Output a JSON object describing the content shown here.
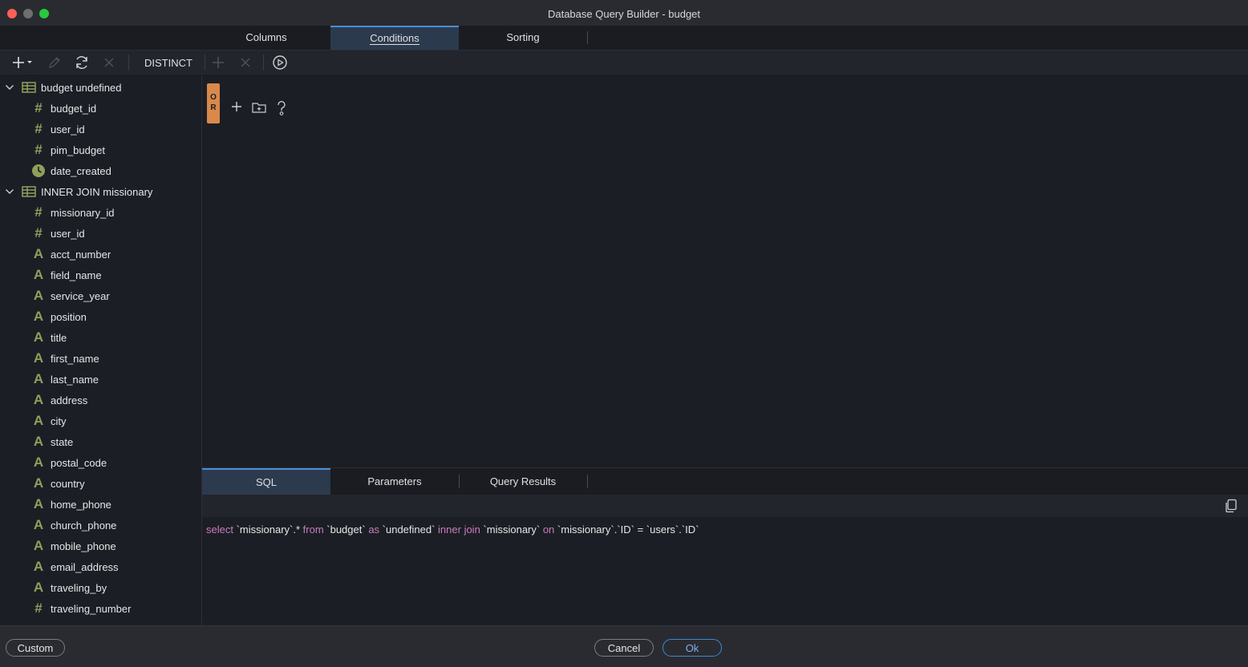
{
  "window": {
    "title": "Database Query Builder - budget"
  },
  "top_tabs": [
    {
      "label": "Columns"
    },
    {
      "label": "Conditions"
    },
    {
      "label": "Sorting"
    }
  ],
  "toolbar": {
    "distinct_label": "DISTINCT"
  },
  "tree": {
    "table1": {
      "label": "budget undefined",
      "fields": [
        {
          "label": "budget_id",
          "type": "#"
        },
        {
          "label": "user_id",
          "type": "#"
        },
        {
          "label": "pim_budget",
          "type": "#"
        },
        {
          "label": "date_created",
          "type": "clock"
        }
      ]
    },
    "table2": {
      "label": "INNER JOIN missionary",
      "fields": [
        {
          "label": "missionary_id",
          "type": "#"
        },
        {
          "label": "user_id",
          "type": "#"
        },
        {
          "label": "acct_number",
          "type": "A"
        },
        {
          "label": "field_name",
          "type": "A"
        },
        {
          "label": "service_year",
          "type": "A"
        },
        {
          "label": "position",
          "type": "A"
        },
        {
          "label": "title",
          "type": "A"
        },
        {
          "label": "first_name",
          "type": "A"
        },
        {
          "label": "last_name",
          "type": "A"
        },
        {
          "label": "address",
          "type": "A"
        },
        {
          "label": "city",
          "type": "A"
        },
        {
          "label": "state",
          "type": "A"
        },
        {
          "label": "postal_code",
          "type": "A"
        },
        {
          "label": "country",
          "type": "A"
        },
        {
          "label": "home_phone",
          "type": "A"
        },
        {
          "label": "church_phone",
          "type": "A"
        },
        {
          "label": "mobile_phone",
          "type": "A"
        },
        {
          "label": "email_address",
          "type": "A"
        },
        {
          "label": "traveling_by",
          "type": "A"
        },
        {
          "label": "traveling_number",
          "type": "#"
        }
      ]
    }
  },
  "conditions": {
    "group_operator": [
      "O",
      "R"
    ]
  },
  "bottom_tabs": [
    {
      "label": "SQL"
    },
    {
      "label": "Parameters"
    },
    {
      "label": "Query Results"
    }
  ],
  "sql": {
    "tokens": [
      {
        "t": "select",
        "kw": true
      },
      {
        "t": " `missionary`.* ",
        "kw": false
      },
      {
        "t": "from",
        "kw": true
      },
      {
        "t": " `budget` ",
        "kw": false
      },
      {
        "t": "as",
        "kw": true
      },
      {
        "t": " `undefined` ",
        "kw": false
      },
      {
        "t": "inner join",
        "kw": true
      },
      {
        "t": " `missionary` ",
        "kw": false
      },
      {
        "t": "on",
        "kw": true
      },
      {
        "t": " `missionary`.`ID` = `users`.`ID`",
        "kw": false
      }
    ]
  },
  "footer": {
    "custom_label": "Custom",
    "cancel_label": "Cancel",
    "ok_label": "Ok"
  },
  "colors": {
    "accent": "#4a8fd6",
    "field_icon": "#8fa05a",
    "or_badge": "#d9894a",
    "keyword": "#c77dba"
  }
}
